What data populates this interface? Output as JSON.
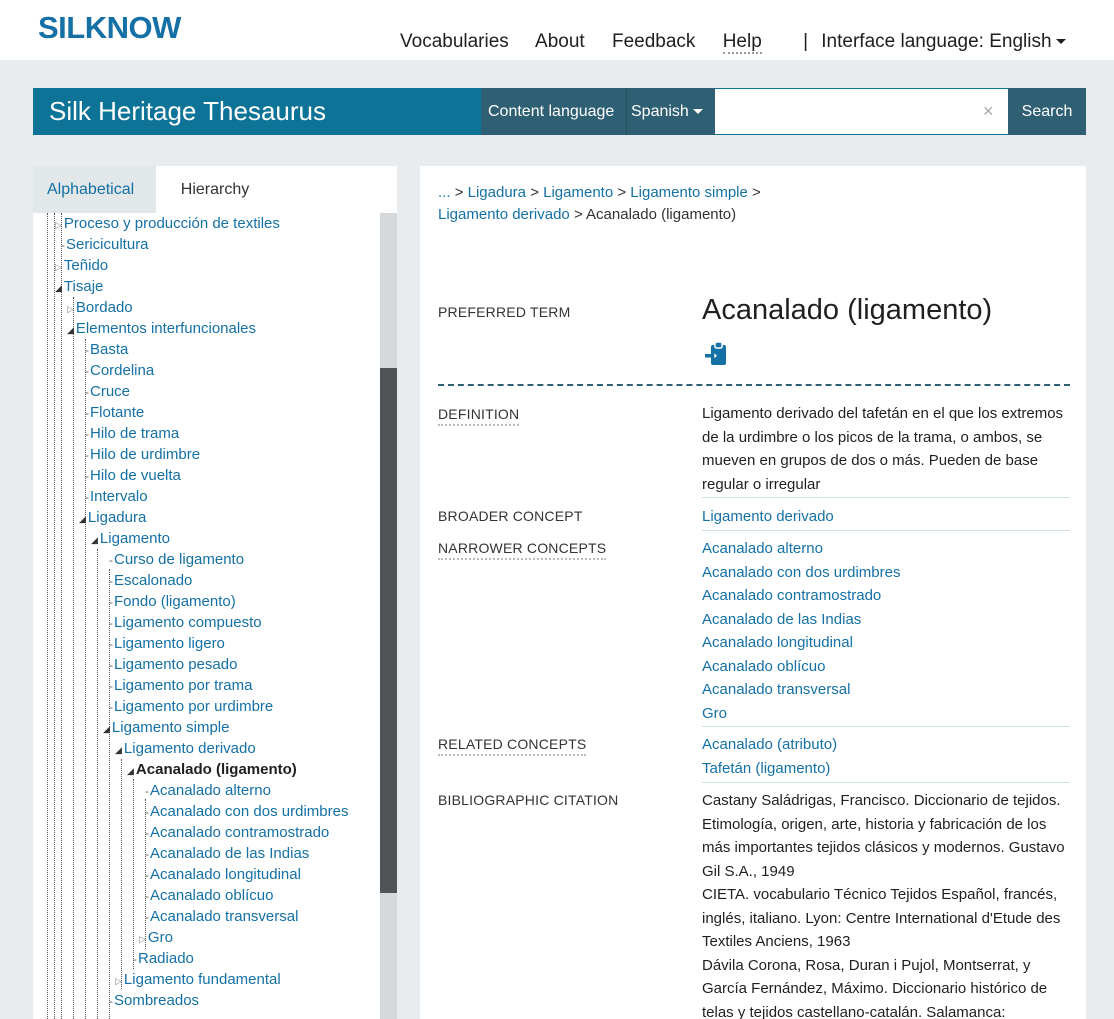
{
  "topbar": {
    "logo": "SILKNOW",
    "nav": [
      "Vocabularies",
      "About",
      "Feedback",
      "Help"
    ],
    "separator": "|",
    "interface_language_label": "Interface language:",
    "interface_language_value": "English"
  },
  "header": {
    "site_title": "Silk Heritage Thesaurus",
    "content_language_label": "Content language",
    "content_language_value": "Spanish",
    "search_placeholder": "",
    "search_button": "Search",
    "clear_symbol": "×"
  },
  "sidebar": {
    "tabs": [
      "Alphabetical",
      "Hierarchy"
    ],
    "tree": [
      "Proceso y producción de textiles",
      "Sericicultura",
      "Teñido",
      "Tisaje",
      "Bordado",
      "Elementos interfuncionales",
      "Basta",
      "Cordelina",
      "Cruce",
      "Flotante",
      "Hilo de trama",
      "Hilo de urdimbre",
      "Hilo de vuelta",
      "Intervalo",
      "Ligadura",
      "Ligamento",
      "Curso de ligamento",
      "Escalonado",
      "Fondo (ligamento)",
      "Ligamento compuesto",
      "Ligamento ligero",
      "Ligamento pesado",
      "Ligamento por trama",
      "Ligamento por urdimbre",
      "Ligamento simple",
      "Ligamento derivado",
      "Acanalado (ligamento)",
      "Acanalado alterno",
      "Acanalado con dos urdimbres",
      "Acanalado contramostrado",
      "Acanalado de las Indias",
      "Acanalado longitudinal",
      "Acanalado oblícuo",
      "Acanalado transversal",
      "Gro",
      "Radiado",
      "Ligamento fundamental",
      "Sombreados"
    ]
  },
  "main": {
    "breadcrumb": {
      "ellipsis": "...",
      "sep": ">",
      "items": [
        "Ligadura",
        "Ligamento",
        "Ligamento simple",
        "Ligamento derivado"
      ],
      "current": "Acanalado (ligamento)"
    },
    "preferred_term_label": "PREFERRED TERM",
    "preferred_term": "Acanalado (ligamento)",
    "definition_label": "DEFINITION",
    "definition": "Ligamento derivado del tafetán en el que los extremos de la urdimbre o los picos de la trama, o ambos, se mueven en grupos de dos o más. Pueden de base regular o irregular",
    "broader_label": "BROADER CONCEPT",
    "broader": "Ligamento derivado",
    "narrower_label": "NARROWER CONCEPTS",
    "narrower": [
      "Acanalado alterno",
      "Acanalado con dos urdimbres",
      "Acanalado contramostrado",
      "Acanalado de las Indias",
      "Acanalado longitudinal",
      "Acanalado oblícuo",
      "Acanalado transversal",
      "Gro"
    ],
    "related_label": "RELATED CONCEPTS",
    "related": [
      "Acanalado (atributo)",
      "Tafetán (ligamento)"
    ],
    "citation_label": "BIBLIOGRAPHIC CITATION",
    "citation": [
      "Castany Saládrigas, Francisco. Diccionario de tejidos. Etimología, origen, arte, historia y fabricación de los más importantes tejidos clásicos y modernos. Gustavo Gil S.A., 1949",
      "CIETA. vocabulario Técnico Tejidos Español, francés, inglés, italiano. Lyon: Centre International d'Etude des Textiles Anciens, 1963",
      "Dávila Corona, Rosa, Duran i Pujol, Montserrat, y García Fernández, Máximo. Diccionario histórico de telas y tejidos castellano-catalán. Salamanca:"
    ]
  },
  "colors": {
    "brand_blue": "#1470a5",
    "header_teal": "#0d7397",
    "header_dark": "#2f5f73"
  },
  "icons": {
    "copy_to_clipboard": "clipboard-icon",
    "clear_search": "close-icon",
    "dropdown": "caret-down-icon"
  }
}
